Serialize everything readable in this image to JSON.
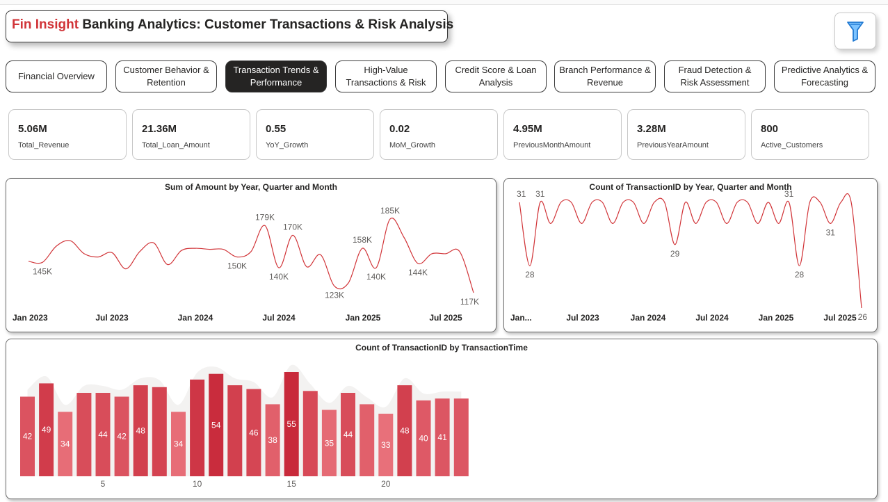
{
  "header": {
    "brand": "Fin Insight",
    "title": "Banking Analytics: Customer Transactions & Risk Analysis",
    "filter_icon": "funnel-icon"
  },
  "tabs": [
    {
      "label": "Financial Overview",
      "active": false
    },
    {
      "label": "Customer Behavior & Retention",
      "active": false
    },
    {
      "label": "Transaction Trends & Performance",
      "active": true
    },
    {
      "label": "High-Value Transactions & Risk",
      "active": false
    },
    {
      "label": "Credit Score & Loan Analysis",
      "active": false
    },
    {
      "label": "Branch Performance & Revenue",
      "active": false
    },
    {
      "label": "Fraud Detection & Risk Assessment",
      "active": false
    },
    {
      "label": "Predictive Analytics & Forecasting",
      "active": false
    }
  ],
  "kpis": [
    {
      "value": "5.06M",
      "label": "Total_Revenue"
    },
    {
      "value": "21.36M",
      "label": "Total_Loan_Amount"
    },
    {
      "value": "0.55",
      "label": "YoY_Growth"
    },
    {
      "value": "0.02",
      "label": "MoM_Growth"
    },
    {
      "value": "4.95M",
      "label": "PreviousMonthAmount"
    },
    {
      "value": "3.28M",
      "label": "PreviousYearAmount"
    },
    {
      "value": "800",
      "label": "Active_Customers"
    }
  ],
  "chart_data": [
    {
      "type": "line",
      "title": "Sum of Amount by Year, Quarter and Month",
      "color": "#d13438",
      "x_ticks": [
        "Jan 2023",
        "Jul 2023",
        "Jan 2024",
        "Jul 2024",
        "Jan 2025",
        "Jul 2025"
      ],
      "values": [
        146000,
        145000,
        160000,
        165000,
        153000,
        150000,
        154000,
        139000,
        155000,
        163000,
        143000,
        156000,
        158000,
        157000,
        157000,
        150000,
        155000,
        179000,
        140000,
        170000,
        141000,
        152000,
        123000,
        126000,
        158000,
        140000,
        185000,
        168000,
        144000,
        153000,
        153000,
        155000,
        117000
      ],
      "data_labels": [
        {
          "index": 1,
          "text": "145K"
        },
        {
          "index": 15,
          "text": "150K"
        },
        {
          "index": 17,
          "text": "179K"
        },
        {
          "index": 18,
          "text": "140K"
        },
        {
          "index": 19,
          "text": "170K"
        },
        {
          "index": 22,
          "text": "123K"
        },
        {
          "index": 24,
          "text": "158K"
        },
        {
          "index": 25,
          "text": "140K"
        },
        {
          "index": 26,
          "text": "185K"
        },
        {
          "index": 28,
          "text": "144K"
        },
        {
          "index": 32,
          "text": "117K"
        }
      ]
    },
    {
      "type": "line",
      "title": "Count of TransactionID by Year, Quarter and Month",
      "color": "#d13438",
      "x_ticks": [
        "Jan...",
        "Jul 2023",
        "Jan 2024",
        "Jul 2024",
        "Jan 2025",
        "Jul 2025"
      ],
      "values": [
        31,
        28,
        31,
        30,
        31,
        31,
        30,
        31,
        31,
        30,
        31,
        31,
        30,
        31,
        31,
        29,
        31,
        30,
        31,
        31,
        30,
        31,
        31,
        30,
        31,
        30,
        31,
        28,
        31,
        31,
        30,
        31,
        31,
        26
      ],
      "data_labels": [
        {
          "index": 0,
          "text": "31"
        },
        {
          "index": 1,
          "text": "28"
        },
        {
          "index": 2,
          "text": "31"
        },
        {
          "index": 15,
          "text": "29"
        },
        {
          "index": 26,
          "text": "31"
        },
        {
          "index": 27,
          "text": "28"
        },
        {
          "index": 30,
          "text": "31"
        },
        {
          "index": 33,
          "text": "26"
        }
      ]
    },
    {
      "type": "bar",
      "title": "Count of TransactionID by TransactionTime",
      "categories": [
        1,
        2,
        3,
        4,
        5,
        6,
        7,
        8,
        9,
        10,
        11,
        12,
        13,
        14,
        15,
        16,
        17,
        18,
        19,
        20,
        21,
        22,
        23,
        24
      ],
      "x_tick_labels": [
        "5",
        "10",
        "15",
        "20"
      ],
      "values": [
        42,
        49,
        34,
        44,
        44,
        42,
        48,
        47,
        34,
        51,
        54,
        48,
        46,
        38,
        55,
        45,
        35,
        44,
        38,
        33,
        48,
        40,
        41,
        41
      ],
      "labeled_indices": [
        0,
        1,
        2,
        4,
        5,
        6,
        8,
        10,
        12,
        13,
        14,
        16,
        17,
        19,
        20,
        21,
        22
      ],
      "color_low": "#e8707a",
      "color_high": "#c8293a",
      "background_color": "#f3f2f1"
    }
  ]
}
